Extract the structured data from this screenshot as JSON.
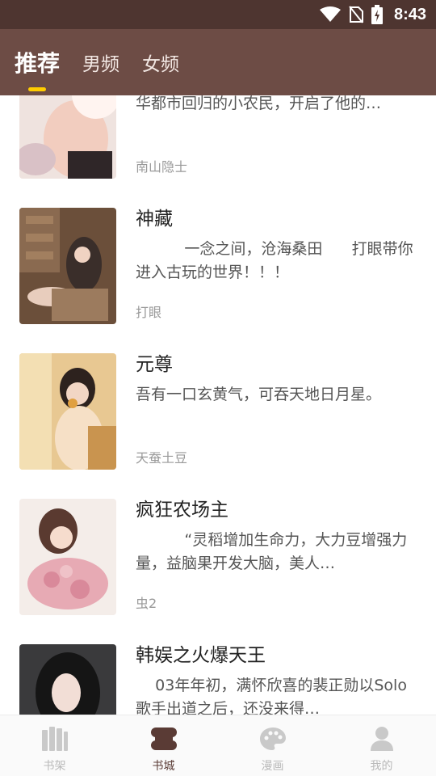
{
  "status_bar": {
    "time": "8:43"
  },
  "tabs": [
    {
      "label": "推荐",
      "active": true
    },
    {
      "label": "男频",
      "active": false
    },
    {
      "label": "女频",
      "active": false
    }
  ],
  "books": [
    {
      "title": "",
      "desc": "华都市回归的小农民，开启了他的…",
      "author": "南山隐士"
    },
    {
      "title": "神藏",
      "desc": "          一念之间，沧海桑田      打眼带你进入古玩的世界！！！",
      "author": "打眼"
    },
    {
      "title": "元尊",
      "desc": "吾有一口玄黄气，可吞天地日月星。",
      "author": "天蚕土豆"
    },
    {
      "title": "疯狂农场主",
      "desc": "          “灵稻增加生命力，大力豆增强力量，益脑果开发大脑，美人…",
      "author": "虫2"
    },
    {
      "title": "韩娱之火爆天王",
      "desc": "    03年年初，满怀欣喜的裴正勋以Solo歌手出道之后，还没来得…",
      "author": ""
    }
  ],
  "bottom_nav": [
    {
      "label": "书架",
      "icon": "bookshelf-icon",
      "active": false
    },
    {
      "label": "书城",
      "icon": "bookstore-icon",
      "active": true
    },
    {
      "label": "漫画",
      "icon": "palette-icon",
      "active": false
    },
    {
      "label": "我的",
      "icon": "person-icon",
      "active": false
    }
  ],
  "colors": {
    "header": "#6d4c45",
    "status_bar": "#4e3530",
    "indicator": "#ffcc00",
    "nav_active": "#5a3b35"
  }
}
